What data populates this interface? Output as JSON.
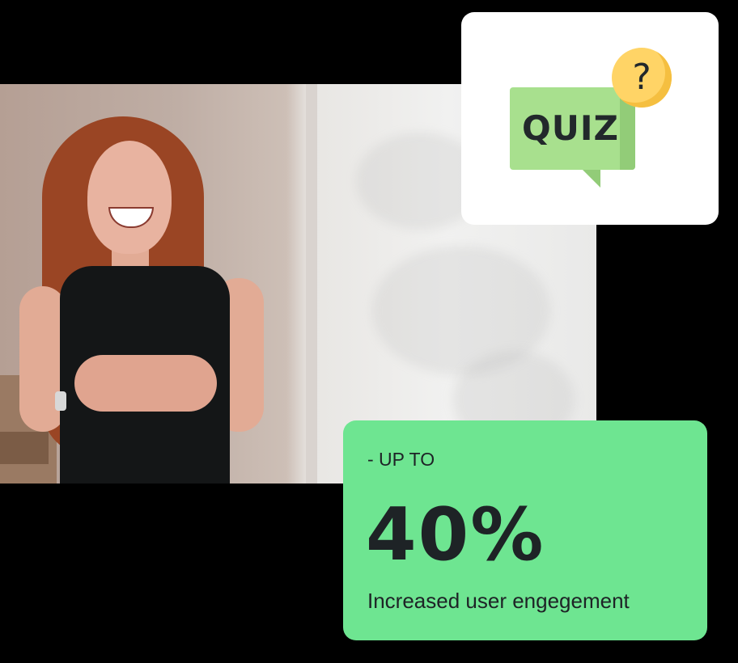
{
  "photo": {
    "subject": "smiling-woman-photo"
  },
  "quiz_card": {
    "bubble_text": "QUIZ",
    "badge_symbol": "?",
    "colors": {
      "bubble": "#a8e08e",
      "badge": "#ffd466"
    }
  },
  "stat_card": {
    "label": "-  UP TO",
    "value": "40%",
    "caption": "Increased user engegement",
    "colors": {
      "background": "#6ee591",
      "text": "#1e2326"
    }
  }
}
